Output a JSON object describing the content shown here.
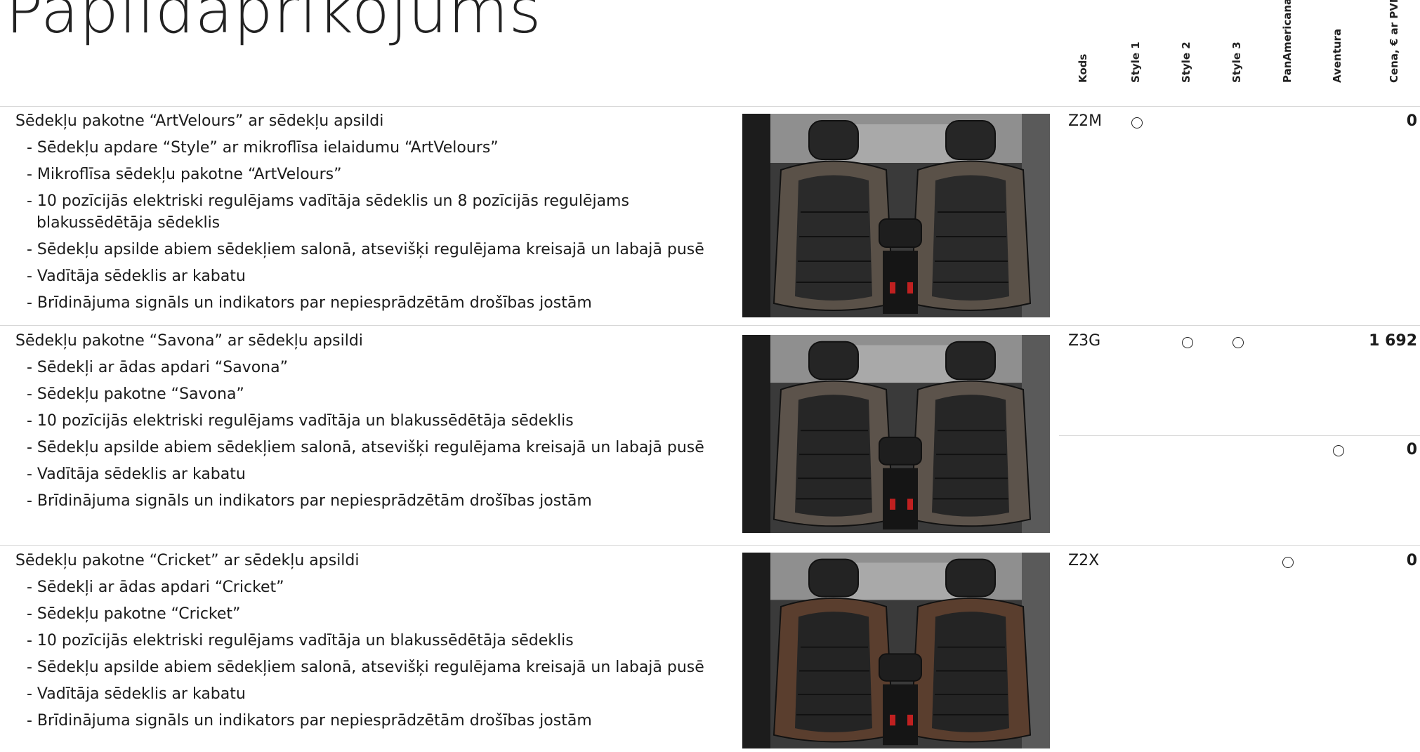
{
  "page": {
    "title": "Papildaprīkojums"
  },
  "columns": [
    "Kods",
    "Style 1",
    "Style 2",
    "Style 3",
    "PanAmericana",
    "Aventura",
    "Cena, € ar PVN"
  ],
  "options": [
    {
      "title": "Sēdekļu pakotne “ArtVelours” ar sēdekļu apsildi",
      "lines": [
        "- Sēdekļu apdare “Style” ar mikroflīsa ielaidumu “ArtVelours”",
        "- Mikroflīsa sēdekļu pakotne “ArtVelours”",
        "- 10 pozīcijās elektriski regulējams vadītāja sēdeklis un 8 pozīcijās regulējams",
        "  blakussēdētāja sēdeklis",
        "- Sēdekļu apsilde abiem sēdekļiem salonā, atsevišķi regulējama kreisajā un labajā pusē",
        "- Vadītāja sēdeklis ar kabatu",
        "- Brīdinājuma signāls un indikators par nepiesprādzētām drošības jostām"
      ],
      "code": "Z2M",
      "entries": [
        {
          "marks": [
            true,
            false,
            false,
            false,
            false
          ],
          "price": "0"
        }
      ],
      "seat_colors": {
        "base": "#262626",
        "bolster": "#5a5148",
        "center": "#2a2a2a"
      }
    },
    {
      "title": "Sēdekļu pakotne “Savona” ar sēdekļu apsildi",
      "lines": [
        "- Sēdekļi ar ādas apdari “Savona”",
        "- Sēdekļu pakotne “Savona”",
        "- 10 pozīcijās elektriski regulējams vadītāja un blakussēdētāja sēdeklis",
        "- Sēdekļu apsilde abiem sēdekļiem salonā, atsevišķi regulējama kreisajā un labajā pusē",
        "- Vadītāja sēdeklis ar kabatu",
        "- Brīdinājuma signāls un indikators par nepiesprādzētām drošības jostām"
      ],
      "code": "Z3G",
      "entries": [
        {
          "marks": [
            false,
            true,
            true,
            false,
            false
          ],
          "price": "1 692"
        },
        {
          "marks": [
            false,
            false,
            false,
            false,
            true
          ],
          "price": "0"
        }
      ],
      "seat_colors": {
        "base": "#252525",
        "bolster": "#5c534b",
        "center": "#262626"
      }
    },
    {
      "title": "Sēdekļu pakotne “Cricket” ar sēdekļu apsildi",
      "lines": [
        "- Sēdekļi ar ādas apdari “Cricket”",
        "- Sēdekļu pakotne “Cricket”",
        "- 10 pozīcijās elektriski regulējams vadītāja un blakussēdētāja sēdeklis",
        "- Sēdekļu apsilde abiem sēdekļiem salonā, atsevišķi regulējama kreisajā un labajā pusē",
        "- Vadītāja sēdeklis ar kabatu",
        "- Brīdinājuma signāls un indikators par nepiesprādzētām drošības jostām"
      ],
      "code": "Z2X",
      "entries": [
        {
          "marks": [
            false,
            false,
            false,
            true,
            false
          ],
          "price": "0"
        }
      ],
      "seat_colors": {
        "base": "#232323",
        "bolster": "#5a3e2e",
        "center": "#242424"
      }
    }
  ]
}
